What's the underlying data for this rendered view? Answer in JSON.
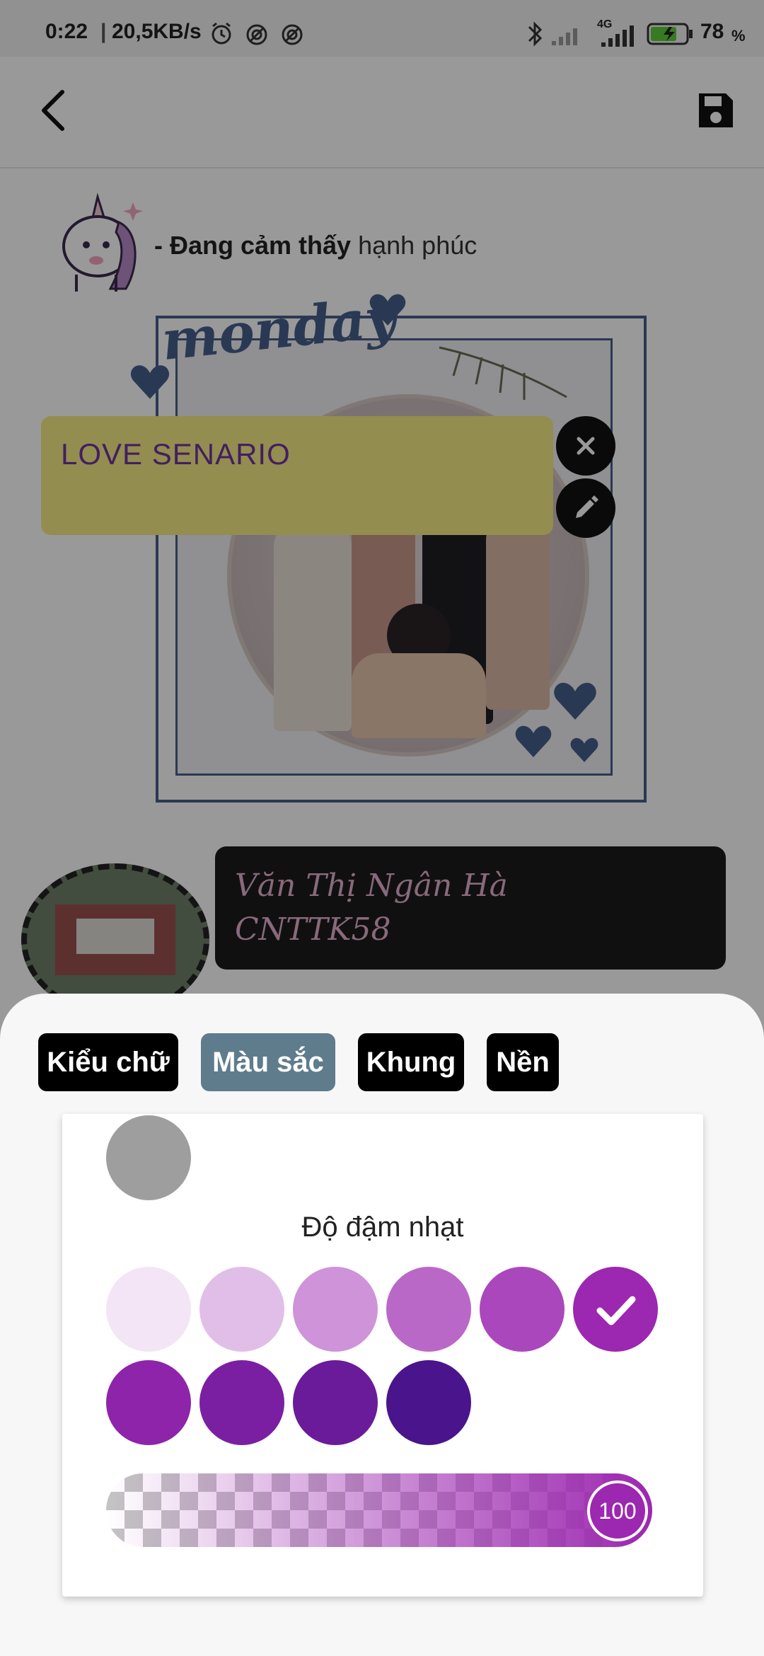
{
  "status_bar": {
    "time": "0:22",
    "speed": "20,5KB/s",
    "network": "4G",
    "battery": "78",
    "battery_unit": "%"
  },
  "app_bar": {
    "back_icon": "chevron-left-icon",
    "save_icon": "save-icon"
  },
  "post": {
    "mood_prefix": "- Đang cảm thấy",
    "mood_value": "hạnh phúc",
    "frame_word": "monday"
  },
  "sticky_note": {
    "text": "LOVE SENARIO",
    "background": "#f6ec84",
    "text_color": "#6f34a4"
  },
  "name_card": {
    "line1": "Văn Thị Ngân Hà",
    "line2": "CNTTK58"
  },
  "editor": {
    "tabs": [
      {
        "label": "Kiểu chữ",
        "active": false
      },
      {
        "label": "Màu sắc",
        "active": true
      },
      {
        "label": "Khung",
        "active": false
      },
      {
        "label": "Nền",
        "active": false
      }
    ],
    "current_color": "#9e9e9e",
    "shade_label": "Độ đậm nhạt",
    "shades": [
      "#f3e5f5",
      "#e1bee7",
      "#ce93d8",
      "#ba68c8",
      "#ab47bc",
      "#9c27b0",
      "#8e24aa",
      "#7b1fa2",
      "#6a1b9a",
      "#4a148c"
    ],
    "selected_shade_index": 5,
    "opacity_value": "100",
    "opacity_fraction": 1.0
  }
}
